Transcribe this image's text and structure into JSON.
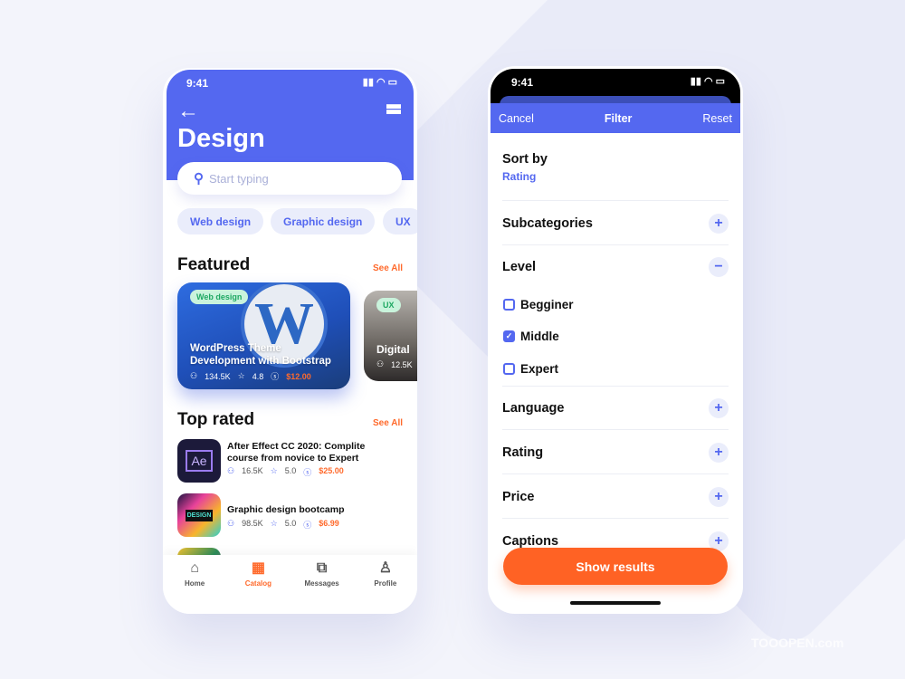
{
  "catalog_screen": {
    "status_time": "9:41",
    "title": "Design",
    "search_placeholder": "Start typing",
    "chips": [
      "Web design",
      "Graphic design",
      "UX"
    ],
    "featured": {
      "heading": "Featured",
      "see_all": "See All",
      "cards": [
        {
          "tag": "Web design",
          "title_line1": "WordPress Theme",
          "title_line2": "Development with Bootstrap",
          "students": "134.5K",
          "rating": "4.8",
          "price": "$12.00"
        },
        {
          "tag": "UX",
          "title": "Digital",
          "students": "12.5K"
        }
      ]
    },
    "top_rated": {
      "heading": "Top rated",
      "see_all": "See All",
      "items": [
        {
          "thumb_text": "Ae",
          "title_line1": "After Effect CC 2020: Complite",
          "title_line2": "course from novice to Expert",
          "students": "16.5K",
          "rating": "5.0",
          "price": "$25.00"
        },
        {
          "thumb_text": "DESIGN",
          "title_line1": "Graphic design bootcamp",
          "students": "98.5K",
          "rating": "5.0",
          "price": "$6.99"
        }
      ]
    },
    "nav": [
      {
        "label": "Home",
        "icon": "home-icon"
      },
      {
        "label": "Catalog",
        "icon": "grid-icon",
        "active": true
      },
      {
        "label": "Messages",
        "icon": "chat-icon"
      },
      {
        "label": "Profile",
        "icon": "user-icon"
      }
    ]
  },
  "filter_screen": {
    "status_time": "9:41",
    "cancel": "Cancel",
    "title": "Filter",
    "reset": "Reset",
    "sort_by": {
      "label": "Sort by",
      "value": "Rating"
    },
    "sections": [
      "Subcategories",
      "Level",
      "Language",
      "Rating",
      "Price",
      "Captions"
    ],
    "level_options": [
      {
        "label": "Begginer",
        "checked": false
      },
      {
        "label": "Middle",
        "checked": true
      },
      {
        "label": "Expert",
        "checked": false
      }
    ],
    "show_results": "Show results"
  },
  "colors": {
    "primary": "#5468f0",
    "accent": "#ff6a2c"
  },
  "watermark": "TOOOPEN.com"
}
